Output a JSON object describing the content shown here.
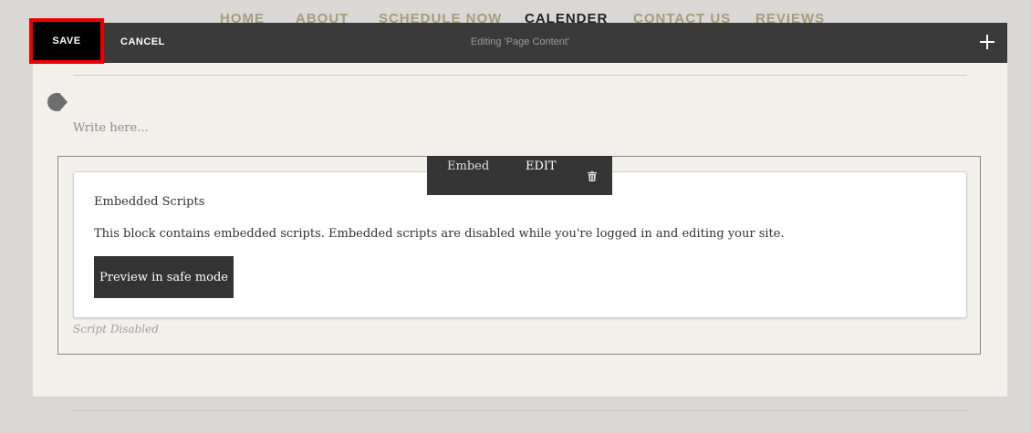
{
  "site_nav": {
    "items": [
      "HOME",
      "ABOUT",
      "SCHEDULE NOW",
      "CALENDER",
      "CONTACT US",
      "REVIEWS"
    ],
    "active": "CALENDER"
  },
  "edit_bar": {
    "save_label": "SAVE",
    "cancel_label": "CANCEL",
    "status": "Editing 'Page Content'",
    "add_icon": "plus-icon"
  },
  "editor": {
    "placeholder": "Write here..."
  },
  "block_toolbar": {
    "type_label": "Embed",
    "edit_label": "EDIT",
    "delete_icon": "trash-icon"
  },
  "embed_block": {
    "title": "Embedded Scripts",
    "description": "This block contains embedded scripts. Embedded scripts are disabled while you're logged in and editing your site.",
    "preview_label": "Preview in safe mode",
    "caption": "Script Disabled"
  },
  "colors": {
    "edit_bar_bg": "#3a3a3a",
    "highlight": "#ee0000",
    "nav_text": "#a39d7a"
  }
}
